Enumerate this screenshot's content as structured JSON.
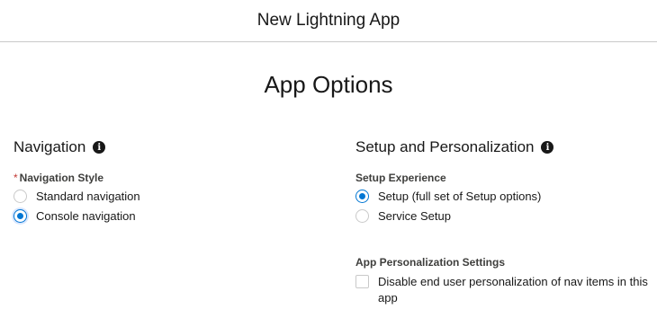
{
  "header": {
    "title": "New Lightning App"
  },
  "page": {
    "section_title": "App Options"
  },
  "navigation": {
    "heading": "Navigation",
    "field_label": "Navigation Style",
    "required_mark": "*",
    "options": [
      {
        "label": "Standard navigation",
        "selected": false
      },
      {
        "label": "Console navigation",
        "selected": true
      }
    ]
  },
  "setup": {
    "heading": "Setup and Personalization",
    "experience_label": "Setup Experience",
    "options": [
      {
        "label": "Setup (full set of Setup options)",
        "selected": true
      },
      {
        "label": "Service Setup",
        "selected": false
      }
    ],
    "personalization_label": "App Personalization Settings",
    "checkbox": {
      "label": "Disable end user personalization of nav items in this app",
      "checked": false
    }
  },
  "colors": {
    "accent": "#0176d3",
    "required": "#c23934",
    "divider": "#c9c9c9"
  }
}
